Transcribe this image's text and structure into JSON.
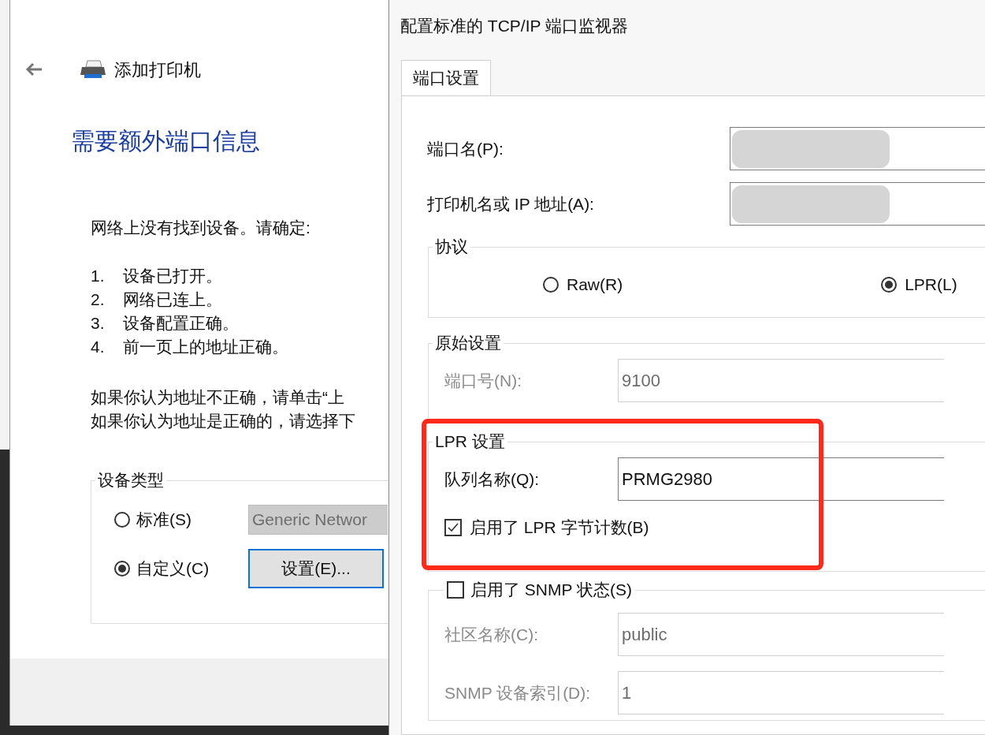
{
  "add_printer": {
    "title": "添加打印机",
    "heading": "需要额外端口信息",
    "intro": "网络上没有找到设备。请确定:",
    "checklist": [
      {
        "number": "1.",
        "text": "设备已打开。"
      },
      {
        "number": "2.",
        "text": "网络已连上。"
      },
      {
        "number": "3.",
        "text": "设备配置正确。"
      },
      {
        "number": "4.",
        "text": "前一页上的地址正确。"
      }
    ],
    "hint_lines": [
      "如果你认为地址不正确，请单击“上",
      "如果你认为地址是正确的，请选择下"
    ],
    "device_type": {
      "legend": "设备类型",
      "options": [
        {
          "label": "标准(S)",
          "selected": false,
          "kind": "dropdown",
          "value": "Generic Networ"
        },
        {
          "label": "自定义(C)",
          "selected": true,
          "kind": "button",
          "button": "设置(E)..."
        }
      ]
    }
  },
  "port_monitor": {
    "title": "配置标准的 TCP/IP 端口监视器",
    "tabs": [
      {
        "label": "端口设置",
        "selected": true
      }
    ],
    "fields": [
      {
        "label": "端口名(P):",
        "redacted": true
      },
      {
        "label": "打印机名或 IP 地址(A):",
        "redacted": true
      }
    ],
    "protocol": {
      "legend": "协议",
      "options": [
        {
          "label": "Raw(R)",
          "selected": false
        },
        {
          "label": "LPR(L)",
          "selected": true
        }
      ]
    },
    "raw_settings": {
      "legend": "原始设置",
      "disabled": true,
      "port_number": {
        "label": "端口号(N):",
        "value": "9100"
      }
    },
    "lpr_settings": {
      "legend": "LPR 设置",
      "queue_name": {
        "label": "队列名称(Q):",
        "value": "PRMG2980"
      },
      "byte_counting": {
        "label": "启用了 LPR 字节计数(B)",
        "checked": true
      }
    },
    "snmp": {
      "label": "启用了 SNMP 状态(S)",
      "checked": false,
      "community": {
        "label": "社区名称(C):",
        "value": "public"
      },
      "device_index": {
        "label": "SNMP 设备索引(D):",
        "value": "1"
      }
    },
    "highlight": true
  }
}
